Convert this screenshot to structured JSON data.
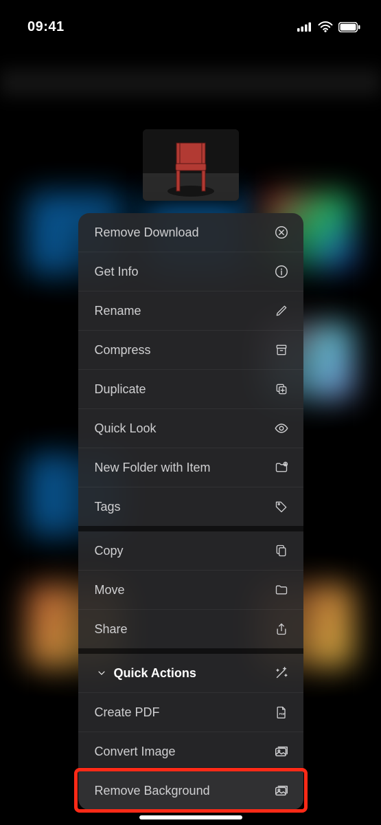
{
  "status": {
    "time": "09:41"
  },
  "menu": {
    "groups": [
      {
        "items": [
          {
            "label": "Remove Download",
            "icon": "remove-download"
          },
          {
            "label": "Get Info",
            "icon": "info"
          },
          {
            "label": "Rename",
            "icon": "pencil"
          },
          {
            "label": "Compress",
            "icon": "archive"
          },
          {
            "label": "Duplicate",
            "icon": "duplicate"
          },
          {
            "label": "Quick Look",
            "icon": "eye"
          },
          {
            "label": "New Folder with Item",
            "icon": "folder-plus"
          },
          {
            "label": "Tags",
            "icon": "tag"
          }
        ]
      },
      {
        "items": [
          {
            "label": "Copy",
            "icon": "copy"
          },
          {
            "label": "Move",
            "icon": "folder"
          },
          {
            "label": "Share",
            "icon": "share"
          }
        ]
      },
      {
        "header": {
          "label": "Quick Actions",
          "icon": "sparkle-wand"
        },
        "items": [
          {
            "label": "Create PDF",
            "icon": "pdf"
          },
          {
            "label": "Convert Image",
            "icon": "image-stack"
          },
          {
            "label": "Remove Background",
            "icon": "image-stack",
            "highlighted": true
          }
        ]
      }
    ]
  }
}
